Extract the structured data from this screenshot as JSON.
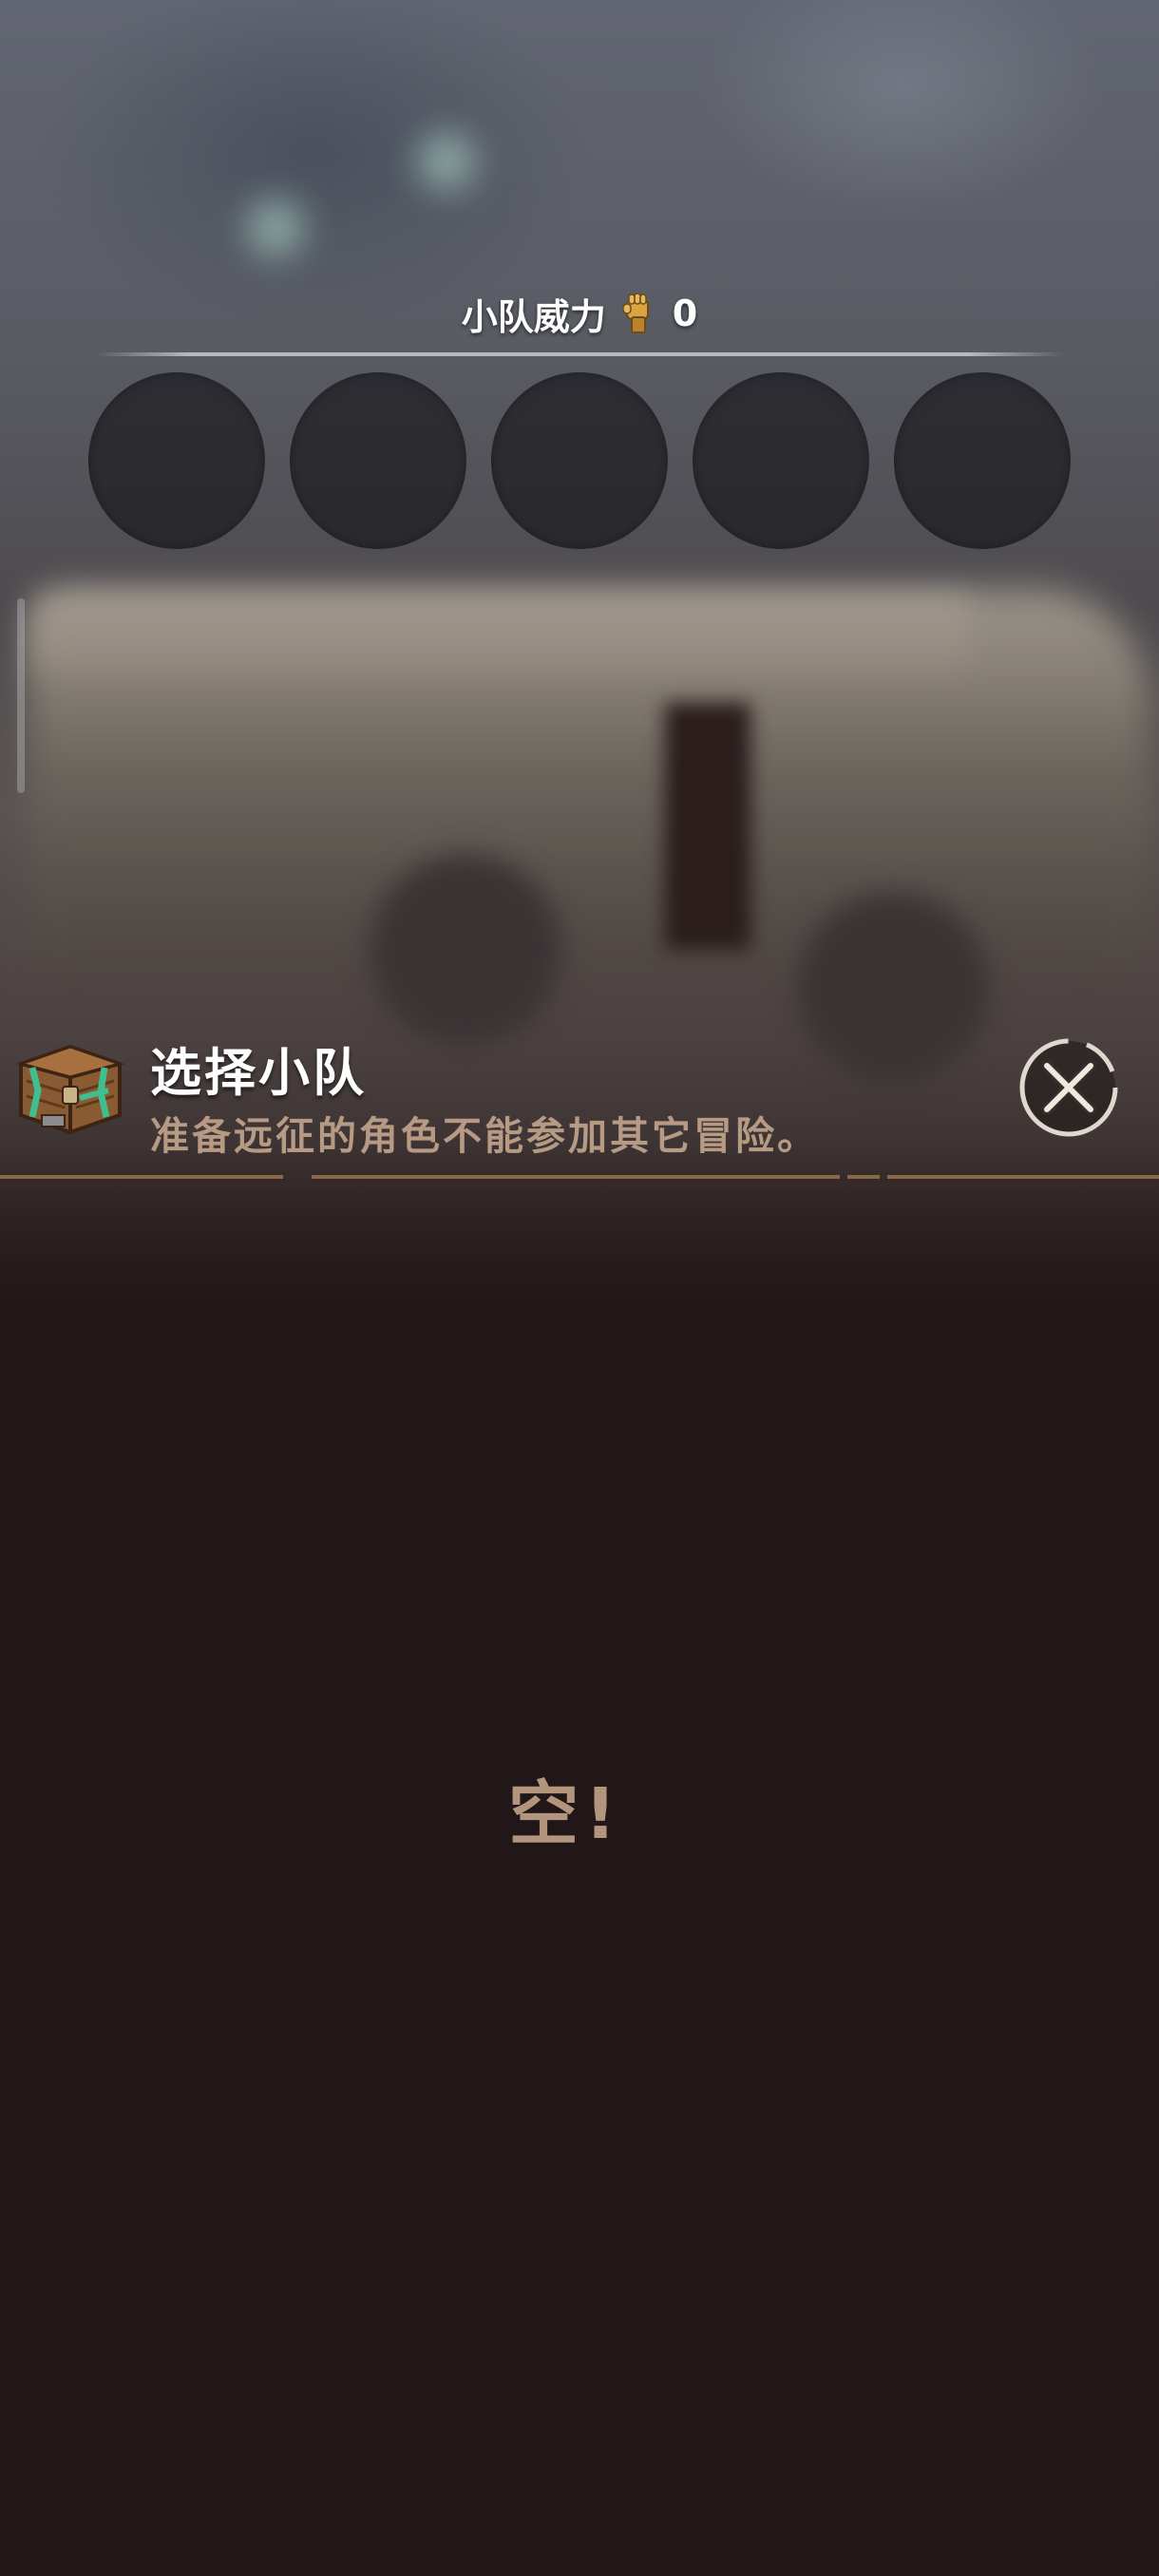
{
  "squad_power": {
    "label": "小队威力",
    "value": "0",
    "icon": "fist-icon"
  },
  "slots": [
    {
      "state": "empty"
    },
    {
      "state": "empty"
    },
    {
      "state": "empty"
    },
    {
      "state": "empty"
    },
    {
      "state": "empty"
    }
  ],
  "panel": {
    "icon": "chest-icon",
    "title": "选择小队",
    "subtitle": "准备远征的角色不能参加其它冒险。",
    "close_icon": "close-icon"
  },
  "list": {
    "empty_text": "空!"
  },
  "colors": {
    "background": "#211718",
    "accent_line": "#8a6a45",
    "subtitle": "#b79a84",
    "empty_text": "#b3957d"
  }
}
